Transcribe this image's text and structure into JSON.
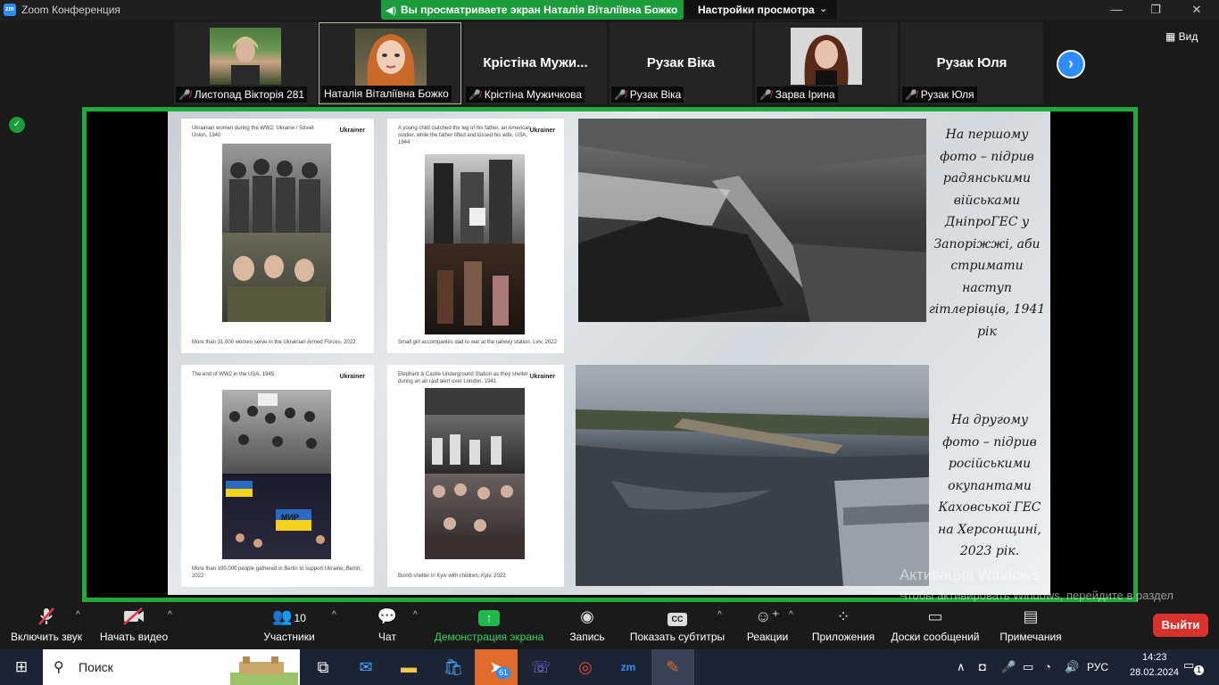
{
  "window": {
    "title": "Zoom Конференция",
    "share_banner": "Вы просматриваете экран Наталія Віталіївна Божко",
    "view_settings": "Настройки просмотра",
    "view_button": "Вид"
  },
  "participants": [
    {
      "name": "Листопад Вікторія 281",
      "display": ""
    },
    {
      "name": "Наталія Віталіївна Божко",
      "display": ""
    },
    {
      "name": "Крістіна Мужичкова",
      "display": "Крістіна  Мужи..."
    },
    {
      "name": "Рузак Віка",
      "display": "Рузак Віка"
    },
    {
      "name": "Зарва Ірина",
      "display": ""
    },
    {
      "name": "Рузак Юля",
      "display": "Рузак Юля"
    }
  ],
  "slide": {
    "cards": [
      {
        "caption": "Ukrainian women during the WW2, Ukraine / Soviet Union, 1940",
        "brand": "Ukrainer",
        "footer": "More than 31,000 women serve in the Ukrainian Armed Forces, 2022"
      },
      {
        "caption": "A young child clutched the leg of his father, an American soldier, while the father lifted and kissed his wife, USA, 1944",
        "brand": "Ukrainer",
        "footer": "Small girl accompanies dad to war at the railway station. Lviv, 2022"
      },
      {
        "caption": "The end of WW2 in the USA, 1945",
        "brand": "Ukrainer",
        "footer": "More than 100,000 people gathered in Berlin to support Ukraine, Berlin, 2022"
      },
      {
        "caption": "Elephant & Castle Underground Station as they shelter during an air raid alert over London, 1941",
        "brand": "Ukrainer",
        "footer": "Bomb shelter in Kyiv with children, Kyiv, 2022"
      }
    ],
    "text1": "На першому фото – підрив радянськими військами ДніпроГЕС у Запоріжжі, аби стримати наступ гітлерівців, 1941 рік",
    "text2": "На другому фото – підрив російськими окупантами Каховської ГЕС на Херсонщині, 2023 рік.",
    "poster_text": "МИР"
  },
  "watermark": {
    "title": "Активация Windows",
    "body": "Чтобы активировать Windows, перейдите в раздел \"Параметры\"."
  },
  "toolbar": {
    "audio": "Включить звук",
    "video": "Начать видео",
    "participants": "Участники",
    "participants_count": "10",
    "chat": "Чат",
    "share": "Демонстрация экрана",
    "record": "Запись",
    "captions": "Показать субтитры",
    "reactions": "Реакции",
    "apps": "Приложения",
    "whiteboards": "Доски сообщений",
    "notes": "Примечания",
    "leave": "Выйти"
  },
  "taskbar": {
    "search": "Поиск",
    "telegram_badge": "61",
    "language": "РУС",
    "time": "14:23",
    "date": "28.02.2024",
    "notifications": "1"
  },
  "colors": {
    "share_green": "#1faa3b",
    "zoom_blue": "#2d8cff",
    "leave_red": "#d9312b",
    "mute_red": "#e0324b"
  }
}
